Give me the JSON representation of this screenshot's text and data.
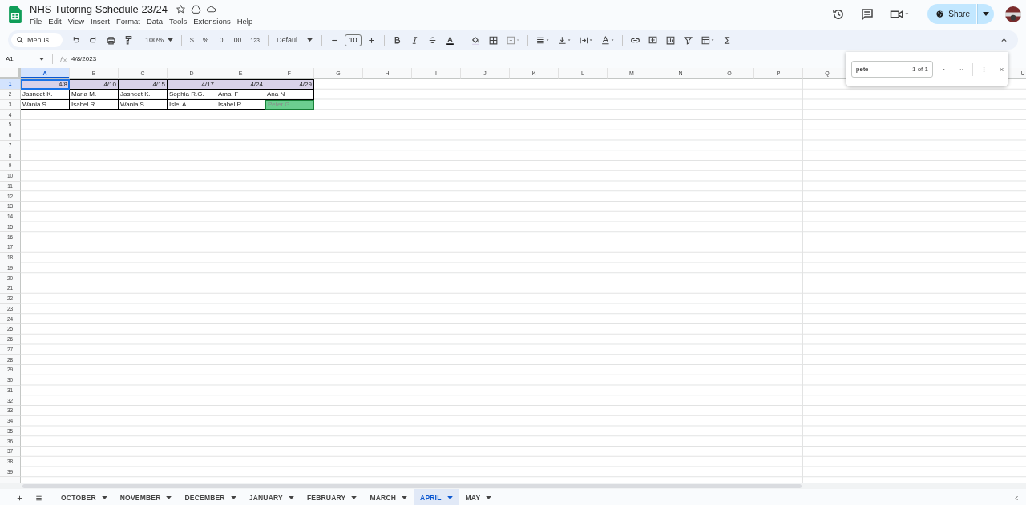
{
  "document": {
    "title": "NHS Tutoring Schedule 23/24",
    "menus": [
      "File",
      "Edit",
      "View",
      "Insert",
      "Format",
      "Data",
      "Tools",
      "Extensions",
      "Help"
    ],
    "share": "Share"
  },
  "toolbar": {
    "search_placeholder": "Menus",
    "zoom": "100%",
    "currency": "$",
    "percent": "%",
    "decrease_decimals": ".0",
    "increase_decimals": ".00",
    "number_format": "123",
    "font": "Defaul...",
    "font_size": "10"
  },
  "formula_bar": {
    "name_box": "A1",
    "formula": "4/8/2023"
  },
  "columns": [
    {
      "label": "A",
      "selected": true
    },
    {
      "label": "B",
      "selected": false
    },
    {
      "label": "C",
      "selected": false
    },
    {
      "label": "D",
      "selected": false
    },
    {
      "label": "E",
      "selected": false
    },
    {
      "label": "F",
      "selected": false
    },
    {
      "label": "G",
      "selected": false
    },
    {
      "label": "H",
      "selected": false
    },
    {
      "label": "I",
      "selected": false
    },
    {
      "label": "J",
      "selected": false
    },
    {
      "label": "K",
      "selected": false
    },
    {
      "label": "L",
      "selected": false
    },
    {
      "label": "M",
      "selected": false
    },
    {
      "label": "N",
      "selected": false
    },
    {
      "label": "O",
      "selected": false
    },
    {
      "label": "P",
      "selected": false
    },
    {
      "label": "Q",
      "selected": false
    },
    {},
    {},
    {},
    {
      "label": "U",
      "selected": false
    }
  ],
  "rows": [
    {
      "number": "1",
      "selected": true,
      "cells": [
        {
          "text": "4/8",
          "kind": "header",
          "selected": true
        },
        {
          "text": "4/10",
          "kind": "header",
          "selected": false
        },
        {
          "text": "4/15",
          "kind": "header",
          "selected": false
        },
        {
          "text": "4/17",
          "kind": "header",
          "selected": false
        },
        {
          "text": "4/24",
          "kind": "header",
          "selected": false
        },
        {
          "text": "4/29",
          "kind": "header",
          "selected": false
        }
      ]
    },
    {
      "number": "2",
      "selected": false,
      "cells": [
        {
          "text": "Jasneet K.",
          "kind": "name",
          "selected": false
        },
        {
          "text": "Maria M.",
          "kind": "name",
          "selected": false
        },
        {
          "text": "Jasneet K.",
          "kind": "name",
          "selected": false
        },
        {
          "text": "Sophia R.G.",
          "kind": "name",
          "selected": false
        },
        {
          "text": "Amal F",
          "kind": "name",
          "selected": false
        },
        {
          "text": "Ana N",
          "kind": "name",
          "selected": false
        }
      ]
    },
    {
      "number": "3",
      "selected": false,
      "cells": [
        {
          "text": "Wania S.",
          "kind": "name",
          "selected": false
        },
        {
          "text": "Isabel R",
          "kind": "name",
          "selected": false
        },
        {
          "text": "Wania S.",
          "kind": "name",
          "selected": false
        },
        {
          "text": "Islei A",
          "kind": "name",
          "selected": false
        },
        {
          "text": "Isabel R",
          "kind": "name",
          "selected": false
        },
        {
          "text": "Peter G.",
          "kind": "match",
          "selected": false
        }
      ]
    },
    {
      "number": "4"
    },
    {
      "number": "5"
    },
    {
      "number": "6"
    },
    {
      "number": "7"
    },
    {
      "number": "8"
    },
    {
      "number": "9"
    },
    {
      "number": "10"
    },
    {
      "number": "11"
    },
    {
      "number": "12"
    },
    {
      "number": "13"
    },
    {
      "number": "14"
    },
    {
      "number": "15"
    },
    {
      "number": "16"
    },
    {
      "number": "17"
    },
    {
      "number": "18"
    },
    {
      "number": "19"
    },
    {
      "number": "20"
    },
    {
      "number": "21"
    },
    {
      "number": "22"
    },
    {
      "number": "23"
    },
    {
      "number": "24"
    },
    {
      "number": "25"
    },
    {
      "number": "26"
    },
    {
      "number": "27"
    },
    {
      "number": "28"
    },
    {
      "number": "29"
    },
    {
      "number": "30"
    },
    {
      "number": "31"
    },
    {
      "number": "32"
    },
    {
      "number": "33"
    },
    {
      "number": "34"
    },
    {
      "number": "35"
    },
    {
      "number": "36"
    },
    {
      "number": "37"
    },
    {
      "number": "38"
    },
    {
      "number": "39"
    }
  ],
  "find": {
    "query": "pete",
    "count": "1 of 1"
  },
  "sheets": [
    {
      "label": "OCTOBER",
      "selected": false
    },
    {
      "label": "NOVEMBER",
      "selected": false
    },
    {
      "label": "DECEMBER",
      "selected": false
    },
    {
      "label": "JANUARY",
      "selected": false
    },
    {
      "label": "FEBRUARY",
      "selected": false
    },
    {
      "label": "MARCH",
      "selected": false
    },
    {
      "label": "APRIL",
      "selected": true
    },
    {
      "label": "MAY",
      "selected": false
    }
  ]
}
